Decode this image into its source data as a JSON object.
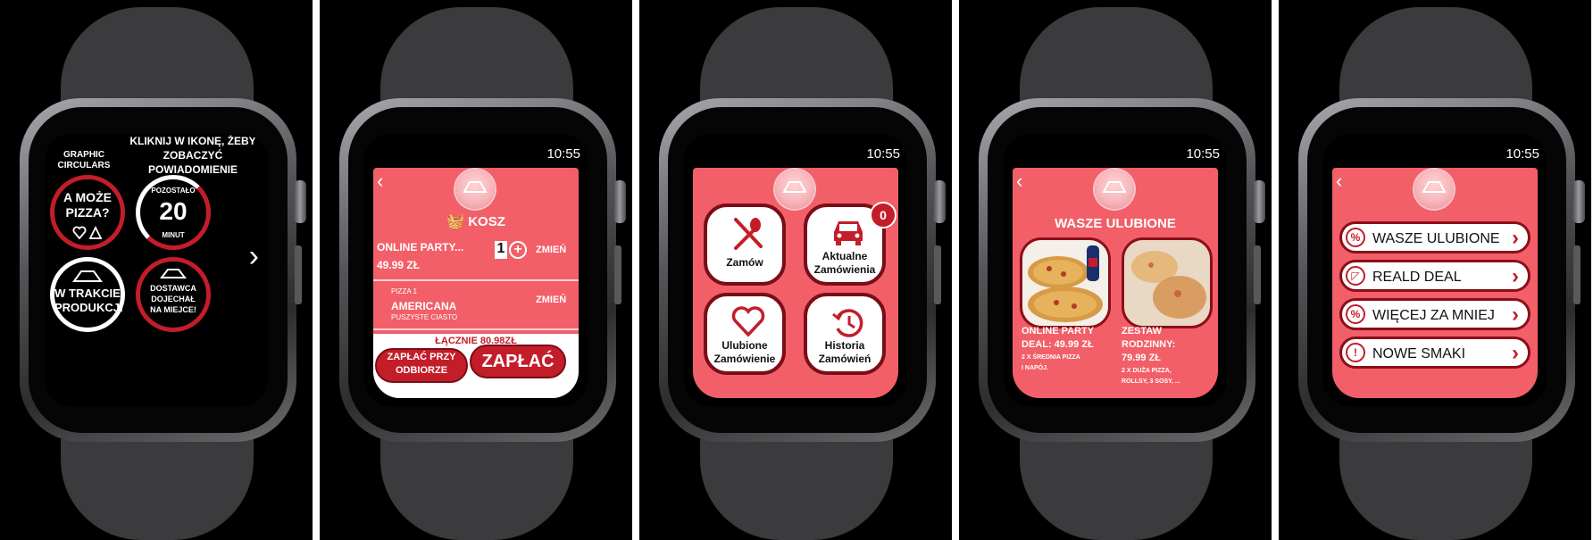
{
  "watch1": {
    "graphic_label": "GRAPHIC\nCIRCULARS",
    "instruction": "KLIKNIJ W IKONĘ, ŻEBY\nZOBACZYĆ\nPOWIADOMIENIE",
    "pizza_circle": "A MOŻE\nPIZZA?",
    "timer_top": "POZOSTAŁO",
    "timer_value": "20",
    "timer_unit": "MINUT",
    "production": "W TRAKCIE\nPRODUKCJI",
    "delivery": "DOSTAWCA\nDOJECHAŁ\nNA MIEJCE!",
    "next_icon": "chevron-right-icon"
  },
  "watch2": {
    "time": "10:55",
    "title": "KOSZ",
    "item1_name": "ONLINE PARTY...",
    "item1_price": "49.99 ZŁ",
    "item1_qty": "1",
    "change1": "ZMIEŃ",
    "item2_sub": "PIZZA 1",
    "item2_name": "AMERICANA",
    "item2_desc": "PUSZYSTE CIASTO",
    "change2": "ZMIEŃ",
    "total": "ŁĄCZNIE 80.98ZŁ",
    "pay_on_pickup": "ZAPŁAĆ PRZY\nODBIORZE",
    "pay": "ZAPŁAĆ"
  },
  "watch3": {
    "time": "10:55",
    "order": "Zamów",
    "current_orders": "Aktualne\nZamówienia",
    "current_badge": "0",
    "favorite_orders": "Ulubione\nZamówienie",
    "history": "Historia\nZamówień"
  },
  "watch4": {
    "time": "10:55",
    "title": "WASZE ULUBIONE",
    "fav1_title": "ONLINE PARTY\nDEAL: 49.99 ZŁ",
    "fav1_desc": "2 X ŚREDNIA PIZZA\nI NAPÓJ.",
    "fav2_title": "ZESTAW\nRODZINNY:\n79.99 ZŁ",
    "fav2_desc": "2 X DUŻA PIZZA,\nROLLSY, 3 SOSY, ..."
  },
  "watch5": {
    "time": "10:55",
    "menu": [
      {
        "label": "WASZE ULUBIONE",
        "icon": "%"
      },
      {
        "label": "REALD DEAL",
        "icon": "◸"
      },
      {
        "label": "WIĘCEJ ZA MNIEJ",
        "icon": "%"
      },
      {
        "label": "NOWE SMAKI",
        "icon": "!"
      }
    ]
  },
  "colors": {
    "accent": "#f25f68",
    "dark_red": "#c41d2a",
    "maroon": "#7a0d16"
  }
}
